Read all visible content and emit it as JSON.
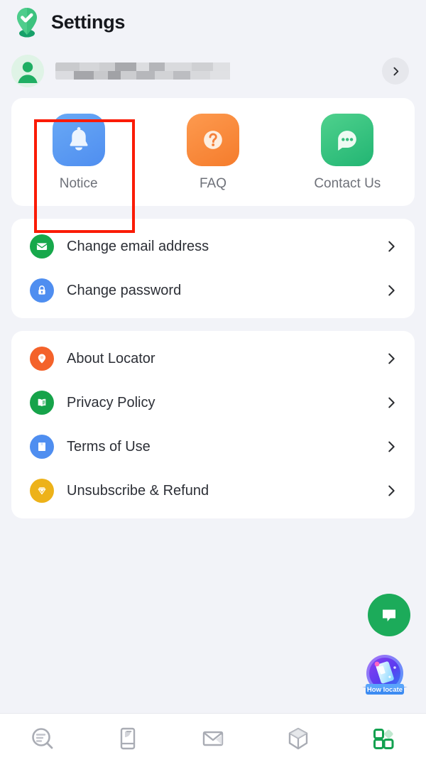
{
  "header": {
    "title": "Settings",
    "logo_icon": "location-check-pin-icon"
  },
  "account": {
    "avatar_icon": "user-avatar-icon",
    "email_redacted": true,
    "chevron_icon": "chevron-right-icon"
  },
  "shortcuts": {
    "items": [
      {
        "label": "Notice",
        "icon": "bell-icon",
        "color": "#4f8ef0",
        "highlighted": true
      },
      {
        "label": "FAQ",
        "icon": "question-mark-icon",
        "color": "#f57c2c",
        "highlighted": false
      },
      {
        "label": "Contact Us",
        "icon": "chat-bubble-icon",
        "color": "#22b573",
        "highlighted": false
      }
    ]
  },
  "account_settings": {
    "items": [
      {
        "label": "Change email address",
        "icon": "envelope-icon",
        "color": "#17a84b"
      },
      {
        "label": "Change password",
        "icon": "lock-icon",
        "color": "#4f8ef0"
      }
    ]
  },
  "info_settings": {
    "items": [
      {
        "label": "About Locator",
        "icon": "map-pin-icon",
        "color": "#f4622a"
      },
      {
        "label": "Privacy Policy",
        "icon": "open-book-icon",
        "color": "#16a34a"
      },
      {
        "label": "Terms of Use",
        "icon": "bookmark-document-icon",
        "color": "#4f8ef0"
      },
      {
        "label": "Unsubscribe & Refund",
        "icon": "diamond-icon",
        "color": "#edb219"
      }
    ]
  },
  "floating": {
    "chat_button_icon": "chat-support-icon",
    "badge_label": "How locate",
    "badge_icon": "how-locate-badge-icon"
  },
  "bottom_nav": {
    "items": [
      {
        "icon": "search-locate-icon",
        "active": false
      },
      {
        "icon": "phone-device-icon",
        "active": false
      },
      {
        "icon": "mail-icon",
        "active": false
      },
      {
        "icon": "package-box-icon",
        "active": false
      },
      {
        "icon": "grid-menu-icon",
        "active": true
      }
    ],
    "active_color": "#12a150",
    "inactive_color": "#a9acb4"
  },
  "annotation": {
    "highlight_color": "#fb1b06",
    "target": "Notice"
  }
}
